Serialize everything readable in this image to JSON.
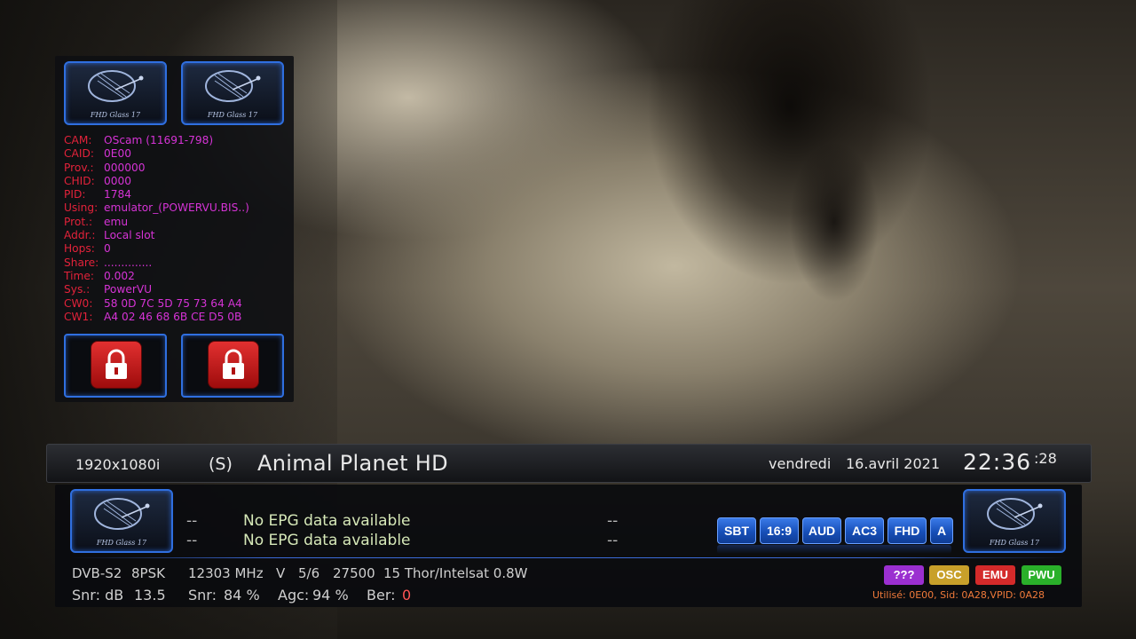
{
  "cam_panel": {
    "logo_text": "FHD Glass 17",
    "rows": [
      {
        "label": "CAM:",
        "value": "OScam (11691-798)"
      },
      {
        "label": "CAID:",
        "value": "0E00"
      },
      {
        "label": "Prov.:",
        "value": "000000"
      },
      {
        "label": "CHID:",
        "value": "0000"
      },
      {
        "label": "PID:",
        "value": "1784"
      },
      {
        "label": "Using:",
        "value": "emulator_(POWERVU.BIS..)"
      },
      {
        "label": "Prot.:",
        "value": "emu"
      },
      {
        "label": "Addr.:",
        "value": "Local slot"
      },
      {
        "label": "Hops:",
        "value": "0"
      },
      {
        "label": "Share:",
        "value": ".............."
      },
      {
        "label": "Time:",
        "value": "0.002"
      },
      {
        "label": "Sys.:",
        "value": "PowerVU"
      },
      {
        "label": "CW0:",
        "value": "58 0D 7C 5D 75 73 64 A4"
      },
      {
        "label": "CW1:",
        "value": "A4 02 46 68 6B CE D5 0B"
      }
    ]
  },
  "channel_bar": {
    "resolution": "1920x1080i",
    "provider_tag": "(S)",
    "channel_name": "Animal Planet HD",
    "day": "vendredi",
    "date": "16.avril 2021",
    "time": "22:36",
    "seconds": ":28"
  },
  "epg": {
    "now": {
      "start": "--",
      "title": "No EPG data available",
      "remaining": "--"
    },
    "next": {
      "start": "--",
      "title": "No EPG data available",
      "remaining": "--"
    }
  },
  "badges": [
    "SBT",
    "16:9",
    "AUD",
    "AC3",
    "FHD",
    "A"
  ],
  "tuner": {
    "system": "DVB-S2",
    "modulation": "8PSK",
    "frequency": "12303 MHz",
    "polarization": "V",
    "fec": "5/6",
    "symbol_rate": "27500",
    "satellite": "15 Thor/Intelsat 0.8W",
    "snr_db_label": "Snr: dB",
    "snr_db_value": "13.5",
    "snr_label": "Snr:",
    "snr_value": "84 %",
    "agc_label": "Agc:",
    "agc_value": "94 %",
    "ber_label": "Ber:",
    "ber_value": "0"
  },
  "cas": {
    "buttons": [
      {
        "label": "???",
        "color": "#9b2fd0"
      },
      {
        "label": "OSC",
        "color": "#c8a02a"
      },
      {
        "label": "EMU",
        "color": "#d42a2a"
      },
      {
        "label": "PWU",
        "color": "#2ab02a"
      }
    ],
    "used_text": "Utilisé: 0E00, Sid: 0A28,VPID: 0A28"
  },
  "colors": {
    "accent_blue": "#2f6fe0",
    "cam_label": "#e2223a",
    "cam_value": "#d633d6",
    "ber_value": "#ff5555"
  }
}
